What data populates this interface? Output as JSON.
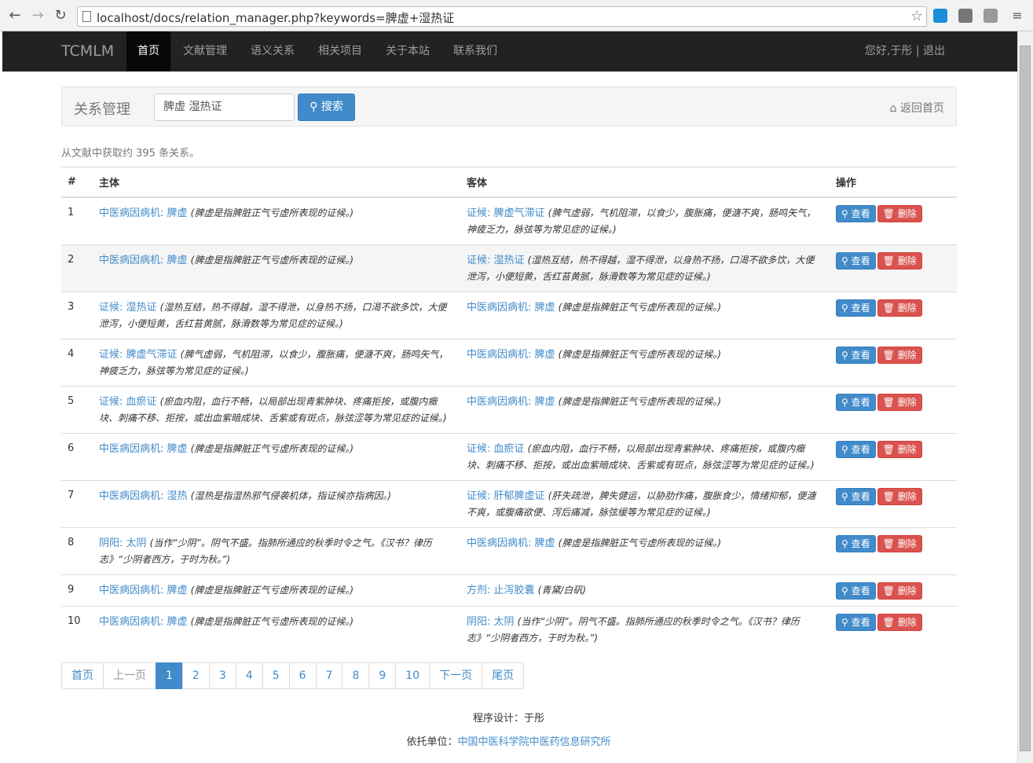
{
  "browser": {
    "url": "localhost/docs/relation_manager.php?keywords=脾虚+湿热证"
  },
  "navbar": {
    "brand": "TCMLM",
    "items": [
      "首页",
      "文献管理",
      "语义关系",
      "相关项目",
      "关于本站",
      "联系我们"
    ],
    "user": "您好,于彤 | 退出"
  },
  "panel": {
    "title": "关系管理",
    "search_value": "脾虚 湿热证",
    "search_button": "搜索",
    "home_link": "返回首页"
  },
  "summary": "从文献中获取约 395 条关系。",
  "table": {
    "headers": [
      "#",
      "主体",
      "客体",
      "操作"
    ],
    "view_label": "查看",
    "delete_label": "删除",
    "rows": [
      {
        "num": "1",
        "subj": "中医病因病机: 脾虚",
        "subj_desc": "(脾虚是指脾脏正气亏虚所表现的证候。)",
        "obj": "证候: 脾虚气滞证",
        "obj_desc": "(脾气虚弱，气机阻滞，以食少，腹胀痛，便溏不爽，肠鸣矢气，神疲乏力，脉弦等为常见症的证候。)"
      },
      {
        "num": "2",
        "subj": "中医病因病机: 脾虚",
        "subj_desc": "(脾虚是指脾脏正气亏虚所表现的证候。)",
        "obj": "证候: 湿热证",
        "obj_desc": "(湿热互结，热不得越，湿不得泄，以身热不扬，口渴不欲多饮，大便泄泻，小便短黄，舌红苔黄腻，脉滑数等为常见症的证候。)"
      },
      {
        "num": "3",
        "subj": "证候: 湿热证",
        "subj_desc": "(湿热互结，热不得越，湿不得泄，以身热不扬，口渴不欲多饮，大便泄泻，小便短黄，舌红苔黄腻，脉滑数等为常见症的证候。)",
        "obj": "中医病因病机: 脾虚",
        "obj_desc": "(脾虚是指脾脏正气亏虚所表现的证候。)"
      },
      {
        "num": "4",
        "subj": "证候: 脾虚气滞证",
        "subj_desc": "(脾气虚弱，气机阻滞，以食少，腹胀痛，便溏不爽，肠鸣矢气，神疲乏力，脉弦等为常见症的证候。)",
        "obj": "中医病因病机: 脾虚",
        "obj_desc": "(脾虚是指脾脏正气亏虚所表现的证候。)"
      },
      {
        "num": "5",
        "subj": "证候: 血瘀证",
        "subj_desc": "(瘀血内阻，血行不畅，以局部出现青紫肿块、疼痛拒按，或腹内癥块、刺痛不移、拒按，或出血紫暗成块、舌紫或有斑点，脉弦涩等为常见症的证候。)",
        "obj": "中医病因病机: 脾虚",
        "obj_desc": "(脾虚是指脾脏正气亏虚所表现的证候。)"
      },
      {
        "num": "6",
        "subj": "中医病因病机: 脾虚",
        "subj_desc": "(脾虚是指脾脏正气亏虚所表现的证候。)",
        "obj": "证候: 血瘀证",
        "obj_desc": "(瘀血内阻，血行不畅，以局部出现青紫肿块、疼痛拒按，或腹内癥块、刺痛不移、拒按，或出血紫暗成块、舌紫或有斑点，脉弦涩等为常见症的证候。)"
      },
      {
        "num": "7",
        "subj": "中医病因病机: 湿热",
        "subj_desc": "(湿热是指湿热邪气侵袭机体，指证候亦指病因。)",
        "obj": "证候: 肝郁脾虚证",
        "obj_desc": "(肝失疏泄，脾失健运，以胁肋作痛，腹胀食少，情绪抑郁，便溏不爽，或腹痛欲便、泻后痛减，脉弦缓等为常见症的证候。)"
      },
      {
        "num": "8",
        "subj": "阴阳: 太阴",
        "subj_desc": "(当作“少阴”。阴气不盛。指肺所通应的秋季时令之气。《汉书？律历志》“少阴者西方，于时为秋。”)",
        "obj": "中医病因病机: 脾虚",
        "obj_desc": "(脾虚是指脾脏正气亏虚所表现的证候。)"
      },
      {
        "num": "9",
        "subj": "中医病因病机: 脾虚",
        "subj_desc": "(脾虚是指脾脏正气亏虚所表现的证候。)",
        "obj": "方剂: 止泻胶囊",
        "obj_desc": "(青黛/白矾)"
      },
      {
        "num": "10",
        "subj": "中医病因病机: 脾虚",
        "subj_desc": "(脾虚是指脾脏正气亏虚所表现的证候。)",
        "obj": "阴阳: 太阴",
        "obj_desc": "(当作“少阴”。阴气不盛。指肺所通应的秋季时令之气。《汉书？律历志》“少阴者西方，于时为秋。”)"
      }
    ]
  },
  "pagination": [
    "首页",
    "上一页",
    "1",
    "2",
    "3",
    "4",
    "5",
    "6",
    "7",
    "8",
    "9",
    "10",
    "下一页",
    "尾页"
  ],
  "pagination_active": "1",
  "footer": {
    "designer": "程序设计：于彤",
    "org_label": "依托单位：",
    "org_link": "中国中医科学院中医药信息研究所"
  },
  "colors": {
    "link": "#428bca",
    "danger": "#d9534f",
    "navbar": "#222222"
  }
}
